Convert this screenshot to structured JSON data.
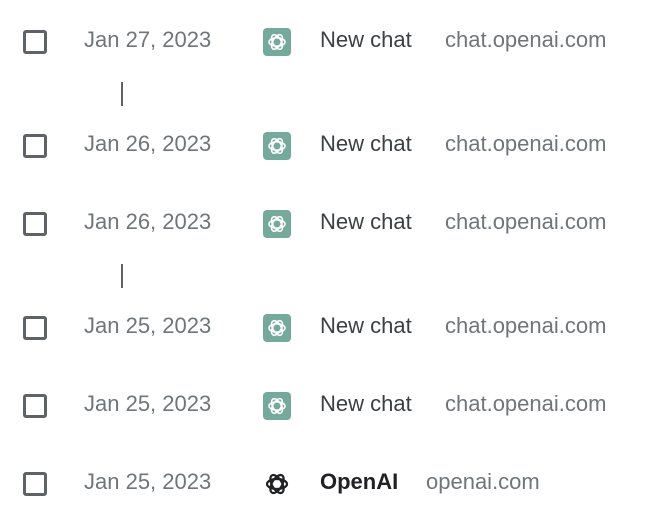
{
  "history": {
    "entries": [
      {
        "date": "Jan 27, 2023",
        "title": "New chat",
        "domain": "chat.openai.com",
        "icon": "chatgpt-favicon-icon"
      },
      {
        "date": "Jan 26, 2023",
        "title": "New chat",
        "domain": "chat.openai.com",
        "icon": "chatgpt-favicon-icon"
      },
      {
        "date": "Jan 26, 2023",
        "title": "New chat",
        "domain": "chat.openai.com",
        "icon": "chatgpt-favicon-icon"
      },
      {
        "date": "Jan 25, 2023",
        "title": "New chat",
        "domain": "chat.openai.com",
        "icon": "chatgpt-favicon-icon"
      },
      {
        "date": "Jan 25, 2023",
        "title": "New chat",
        "domain": "chat.openai.com",
        "icon": "chatgpt-favicon-icon"
      },
      {
        "date": "Jan 25, 2023",
        "title": "OpenAI",
        "domain": "openai.com",
        "icon": "openai-logo-icon"
      }
    ]
  },
  "colors": {
    "chatgpt_favicon_bg": "#75a99c",
    "openai_logo": "#202124",
    "date_text": "#70757a",
    "title_text": "#3c4043"
  }
}
